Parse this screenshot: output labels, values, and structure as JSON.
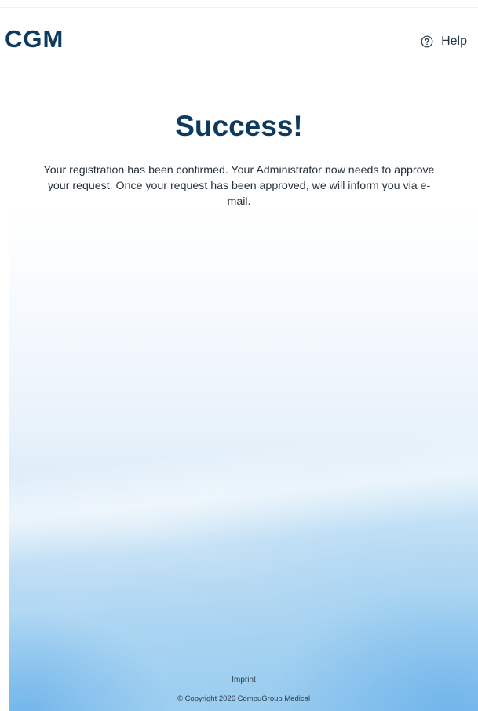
{
  "header": {
    "logo_text": "CGM",
    "help_label": "Help",
    "help_icon": "help-circle-icon"
  },
  "main": {
    "title": "Success!",
    "message": "Your registration has been confirmed. Your Administrator now needs to approve your request. Once your request has been approved, we will inform you via e-mail."
  },
  "footer": {
    "imprint_label": "Imprint",
    "copyright": "© Copyright 2026 CompuGroup Medical"
  },
  "colors": {
    "brand": "#0f3a5f",
    "text": "#25323c",
    "gradient_bottom": "#9fcbee"
  }
}
